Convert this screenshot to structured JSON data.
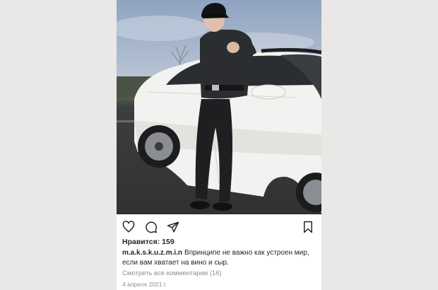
{
  "post": {
    "likes_label": "Нравится:",
    "likes_count": "159",
    "username": "m.a.k.s.k.u.z.m.i.n",
    "caption": "Впринципе не важно как устроен мир, если вам хватает на вино и сыр.",
    "view_comments": "Смотреть все комментарии (16)",
    "date": "4 апреля 2021 г."
  },
  "icons": {
    "like": "heart-icon",
    "comment": "comment-icon",
    "share": "send-icon",
    "save": "bookmark-icon"
  },
  "colors": {
    "car": "#f2f2f0",
    "text": "#262626",
    "muted": "#8e8e8e"
  }
}
